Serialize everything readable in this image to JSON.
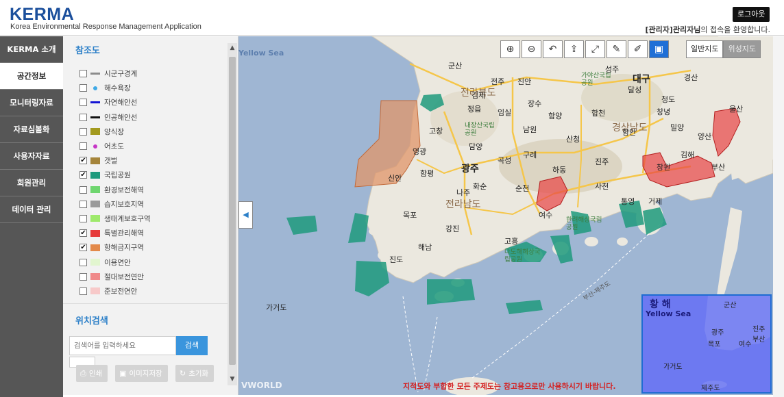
{
  "header": {
    "logo": "KERMA",
    "subtitle": "Korea Environmental Response Management Application",
    "logout_label": "로그아웃",
    "welcome_user": "[관리자]관리자님",
    "welcome_suffix": "의 접속을 환영합니다."
  },
  "nav": {
    "items": [
      {
        "label": "KERMA 소개"
      },
      {
        "label": "공간정보"
      },
      {
        "label": "모니터링자료"
      },
      {
        "label": "자료심볼화"
      },
      {
        "label": "사용자자료"
      },
      {
        "label": "회원관리"
      },
      {
        "label": "데이터 관리"
      }
    ],
    "active_index": 1
  },
  "panel": {
    "title": "참조도",
    "layers": [
      {
        "label": "시군구경계",
        "checked": false,
        "swatch": "line",
        "color": "#8c8c8c"
      },
      {
        "label": "해수욕장",
        "checked": false,
        "swatch": "dot",
        "color": "#3fa9e6"
      },
      {
        "label": "자연해안선",
        "checked": false,
        "swatch": "line",
        "color": "#1414d4"
      },
      {
        "label": "인공해안선",
        "checked": false,
        "swatch": "line",
        "color": "#111111"
      },
      {
        "label": "양식장",
        "checked": false,
        "swatch": "box",
        "color": "#a39a1e"
      },
      {
        "label": "어초도",
        "checked": false,
        "swatch": "dot",
        "color": "#c636c6"
      },
      {
        "label": "갯벌",
        "checked": true,
        "swatch": "box",
        "color": "#a5843a"
      },
      {
        "label": "국립공원",
        "checked": true,
        "swatch": "box",
        "color": "#1f9a7d"
      },
      {
        "label": "환경보전해역",
        "checked": false,
        "swatch": "box",
        "color": "#6fd66f"
      },
      {
        "label": "습지보호지역",
        "checked": false,
        "swatch": "box",
        "color": "#9a9a9a"
      },
      {
        "label": "생태계보호구역",
        "checked": false,
        "swatch": "box",
        "color": "#9ee96b"
      },
      {
        "label": "특별관리해역",
        "checked": true,
        "swatch": "box",
        "color": "#e63a3a"
      },
      {
        "label": "항해금지구역",
        "checked": true,
        "swatch": "box",
        "color": "#e3894a"
      },
      {
        "label": "이용연안",
        "checked": false,
        "swatch": "box",
        "color": "#e2f6cf"
      },
      {
        "label": "절대보전연안",
        "checked": false,
        "swatch": "box",
        "color": "#f08a8a"
      },
      {
        "label": "준보전연안",
        "checked": false,
        "swatch": "box",
        "color": "#f7c9c9"
      }
    ],
    "search_title": "위치검색",
    "search_placeholder": "검색어를 입력하세요",
    "search_button": "검색",
    "print_label": "인쇄",
    "save_image_label": "이미지저장",
    "reset_label": "초기화"
  },
  "map": {
    "toolbar_icons": [
      "zoom-in-icon",
      "zoom-out-icon",
      "refresh-icon",
      "share-icon",
      "fullscreen-icon",
      "pen-icon",
      "edit-icon",
      "minimap-icon"
    ],
    "type_normal": "일반지도",
    "type_satellite": "위성지도",
    "disclaimer": "지적도와 부합한 모든 주제도는 참고용으로만 사용하시기 바랍니다.",
    "labels": {
      "jeonbuk": "전라북도",
      "jeonnam": "전라남도",
      "gyeongnam": "경상남도",
      "daegu": "대구",
      "gwangju": "광주",
      "gunsan": "군산",
      "jeonju": "전주",
      "jinan": "진안",
      "gimje": "김제",
      "jangsu": "장수",
      "imsil": "임실",
      "namwon": "남원",
      "jeongeup": "정읍",
      "gochang": "고창",
      "sunchang": "순창",
      "hamyang": "함양",
      "hapcheon": "합천",
      "sancheong": "산청",
      "yeonggwang": "영광",
      "damyang": "담양",
      "gurye": "구례",
      "gokseong": "곡성",
      "hampyeong": "함평",
      "sinan": "신안",
      "naju": "나주",
      "hwasun": "화순",
      "suncheon": "순천",
      "hadong": "하동",
      "jinju": "진주",
      "sacheon": "사천",
      "haman": "함안",
      "changwon": "창원",
      "gimhae": "김해",
      "yangsan": "양산",
      "miryang": "밀양",
      "changnyeong": "창녕",
      "seongju": "성주",
      "dalseong": "달성",
      "gyeongsan": "경산",
      "cheongdo": "청도",
      "ulsan": "울산",
      "busan": "부산",
      "tongyeong": "통영",
      "geoje": "거제",
      "yeosu": "여수",
      "mokpo": "목포",
      "gangjin": "강진",
      "haenam": "해남",
      "goheung": "고흥",
      "jindo": "진도",
      "gageodo": "가거도",
      "jejudo": "제주도",
      "yellow_sea": "Yellow Sea",
      "gaya_park": "가야산국립공원",
      "naejang_park": "내장산국립공원",
      "hallyeo_park": "한려해상국립공원",
      "dadohae_park": "다도해해상국립공원",
      "route": "부산-제주도",
      "vworld": "VWORLD"
    },
    "minimap_labels": {
      "sea_kr": "황 해",
      "sea_en": "Yellow Sea",
      "gunsan": "군산",
      "gwangju": "광주",
      "busan": "부산",
      "mokpo": "목포",
      "yeosu": "여수",
      "jinju": "진주",
      "gageodo": "가거도",
      "jejudo": "제주도"
    }
  }
}
